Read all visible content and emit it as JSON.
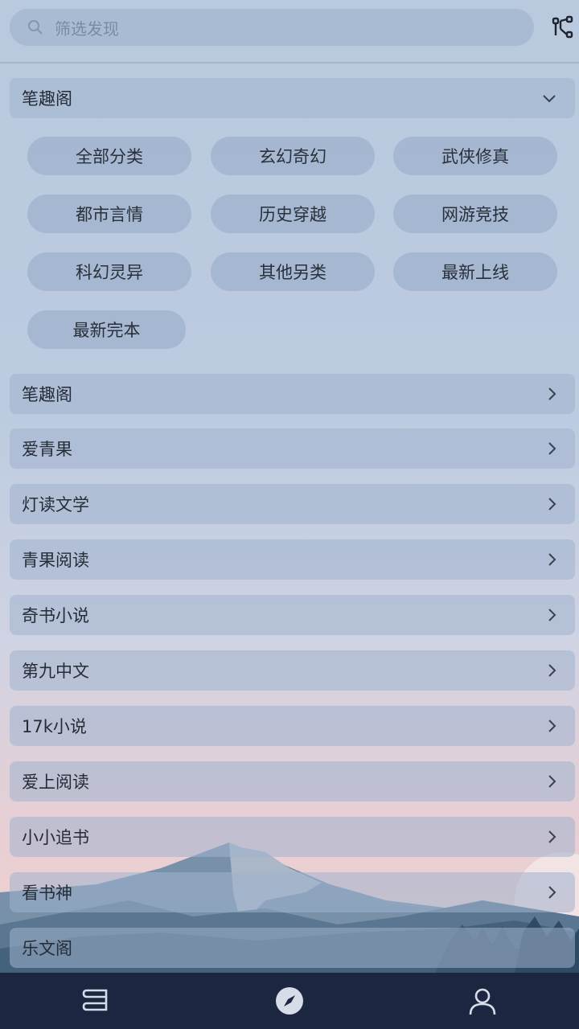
{
  "search": {
    "placeholder": "筛选发现"
  },
  "expanded_section": {
    "title": "笔趣阁",
    "tags": [
      "全部分类",
      "玄幻奇幻",
      "武侠修真",
      "都市言情",
      "历史穿越",
      "网游竞技",
      "科幻灵异",
      "其他另类",
      "最新上线",
      "最新完本"
    ]
  },
  "sources": [
    "笔趣阁",
    "爱青果",
    "灯读文学",
    "青果阅读",
    "奇书小说",
    "第九中文",
    "17k小说",
    "爱上阅读",
    "小小追书",
    "看书神",
    "乐文阁"
  ],
  "icons": {
    "search": "search-icon",
    "share": "share-tree-icon",
    "expand": "chevron-down-icon",
    "row_arrow": "chevron-right-icon",
    "nav": [
      "bookshelf-icon",
      "compass-icon",
      "person-icon"
    ]
  },
  "colors": {
    "nav_bg": "#1c2640",
    "nav_icon": "#d6dce8",
    "row_bg": "#a9bbd2"
  }
}
